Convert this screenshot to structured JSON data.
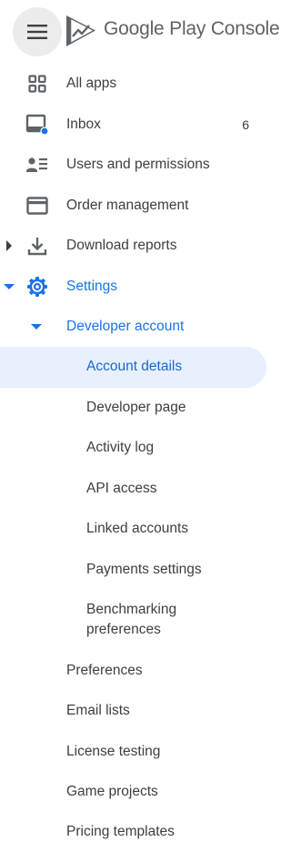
{
  "header": {
    "brand": "Google Play",
    "product": "Console",
    "icons": {
      "menu": "hamburger-menu-icon",
      "logo": "google-play-console-logo"
    }
  },
  "nav": {
    "all_apps": "All apps",
    "inbox": "Inbox",
    "inbox_count": "6",
    "users": "Users and permissions",
    "orders": "Order management",
    "download_reports": "Download reports",
    "settings": "Settings",
    "developer_account": "Developer account",
    "developer_account_items": {
      "account_details": "Account details",
      "developer_page": "Developer page",
      "activity_log": "Activity log",
      "api_access": "API access",
      "linked_accounts": "Linked accounts",
      "payments_settings": "Payments settings",
      "benchmarking_line1": "Benchmarking",
      "benchmarking_line2": "preferences"
    },
    "settings_items": {
      "preferences": "Preferences",
      "email_lists": "Email lists",
      "license_testing": "License testing",
      "game_projects": "Game projects",
      "pricing_templates": "Pricing templates"
    }
  },
  "colors": {
    "accent": "#1a73e8",
    "selected_bg": "#e8f0fe",
    "text": "#3c4043",
    "icon": "#5f6368",
    "badge_dot": "#1a73e8"
  }
}
